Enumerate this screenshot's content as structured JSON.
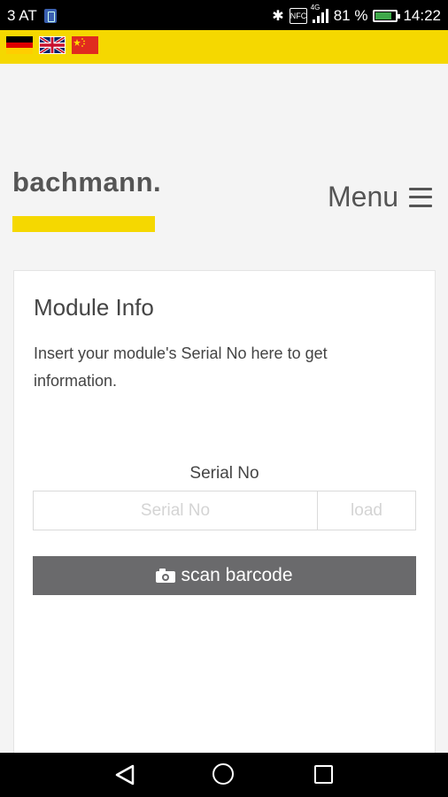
{
  "status_bar": {
    "carrier": "3 AT",
    "nfc_label": "NFC",
    "network_label": "4G",
    "battery": "81 %",
    "time": "14:22",
    "battery_level": 0.81
  },
  "languages": [
    {
      "name": "de-flag-icon"
    },
    {
      "name": "uk-flag-icon"
    },
    {
      "name": "cn-flag-icon"
    }
  ],
  "header": {
    "logo": "bachmann.",
    "menu_label": "Menu",
    "accent_color": "#f5d800"
  },
  "module_info": {
    "title": "Module Info",
    "description": "Insert your module's Serial No here to get information.",
    "serial_label": "Serial No",
    "serial_value": "",
    "serial_placeholder": "Serial No",
    "load_label": "load",
    "scan_label": "scan barcode"
  },
  "icons": {
    "scan": "camera-icon",
    "menu": "hamburger-icon",
    "nav_back": "back-triangle-icon",
    "nav_home": "home-circle-icon",
    "nav_recent": "recent-square-icon"
  }
}
